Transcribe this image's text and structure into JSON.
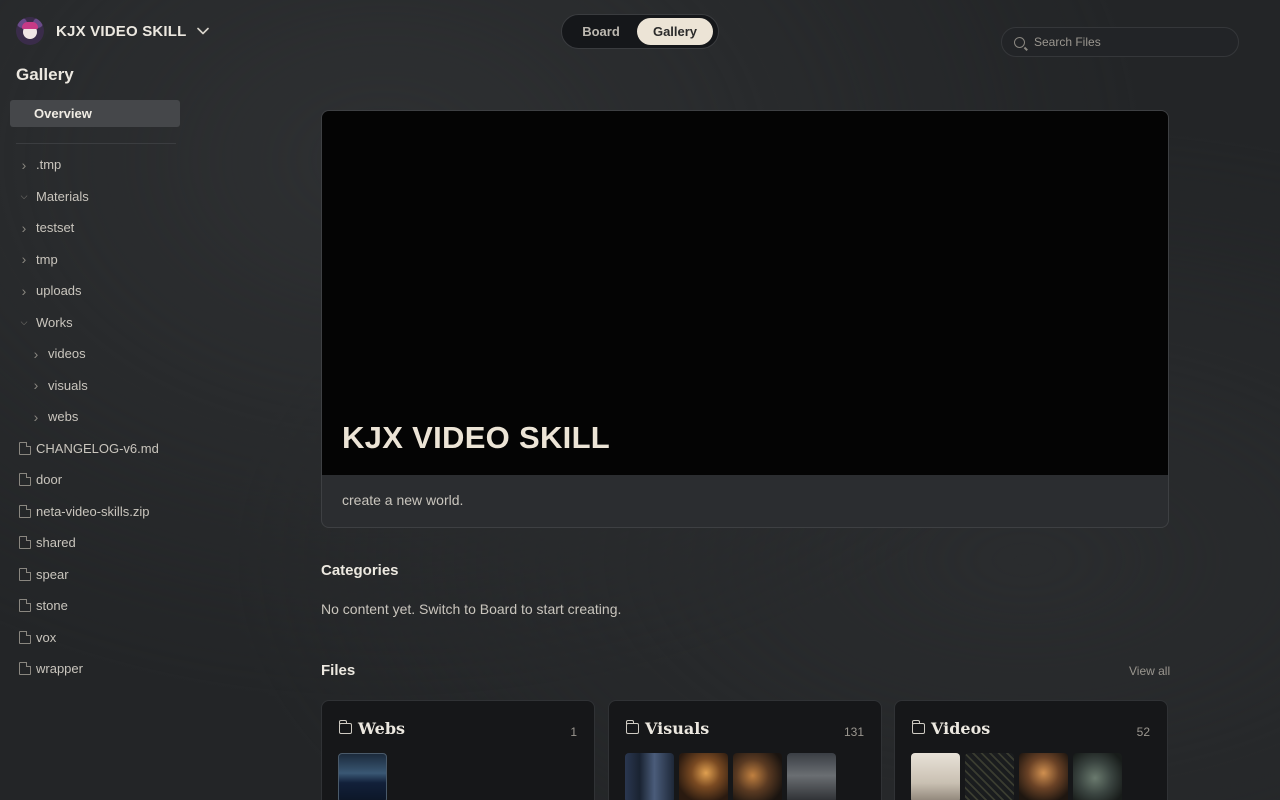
{
  "app": {
    "name": "KJX VIDEO SKILL"
  },
  "sidebar": {
    "title": "Gallery",
    "overview_label": "Overview",
    "tree": [
      {
        "label": ".tmp",
        "kind": "folder",
        "expanded": false,
        "depth": 0
      },
      {
        "label": "Materials",
        "kind": "folder",
        "expanded": true,
        "depth": 0
      },
      {
        "label": "testset",
        "kind": "folder",
        "expanded": false,
        "depth": 0
      },
      {
        "label": "tmp",
        "kind": "folder",
        "expanded": false,
        "depth": 0
      },
      {
        "label": "uploads",
        "kind": "folder",
        "expanded": false,
        "depth": 0
      },
      {
        "label": "Works",
        "kind": "folder",
        "expanded": true,
        "depth": 0
      },
      {
        "label": "videos",
        "kind": "folder",
        "expanded": false,
        "depth": 1
      },
      {
        "label": "visuals",
        "kind": "folder",
        "expanded": false,
        "depth": 1
      },
      {
        "label": "webs",
        "kind": "folder",
        "expanded": false,
        "depth": 1
      },
      {
        "label": "CHANGELOG-v6.md",
        "kind": "file",
        "depth": 0
      },
      {
        "label": "door",
        "kind": "file",
        "depth": 0
      },
      {
        "label": "neta-video-skills.zip",
        "kind": "file",
        "depth": 0
      },
      {
        "label": "shared",
        "kind": "file",
        "depth": 0
      },
      {
        "label": "spear",
        "kind": "file",
        "depth": 0
      },
      {
        "label": "stone",
        "kind": "file",
        "depth": 0
      },
      {
        "label": "vox",
        "kind": "file",
        "depth": 0
      },
      {
        "label": "wrapper",
        "kind": "file",
        "depth": 0
      }
    ]
  },
  "view_toggle": {
    "board_label": "Board",
    "gallery_label": "Gallery",
    "active": "Gallery"
  },
  "search": {
    "placeholder": "Search Files",
    "value": ""
  },
  "hero": {
    "title": "KJX VIDEO SKILL",
    "description": "create a new world."
  },
  "categories": {
    "title": "Categories",
    "empty_text": "No content yet. Switch to Board to start creating."
  },
  "files": {
    "title": "Files",
    "view_all_label": "View all",
    "folders": [
      {
        "name": "Webs",
        "count": "1"
      },
      {
        "name": "Visuals",
        "count": "131"
      },
      {
        "name": "Videos",
        "count": "52"
      }
    ]
  },
  "colors": {
    "accent_pill": "#ece4d6",
    "background": "#232527",
    "hero_dark": "#040404"
  }
}
